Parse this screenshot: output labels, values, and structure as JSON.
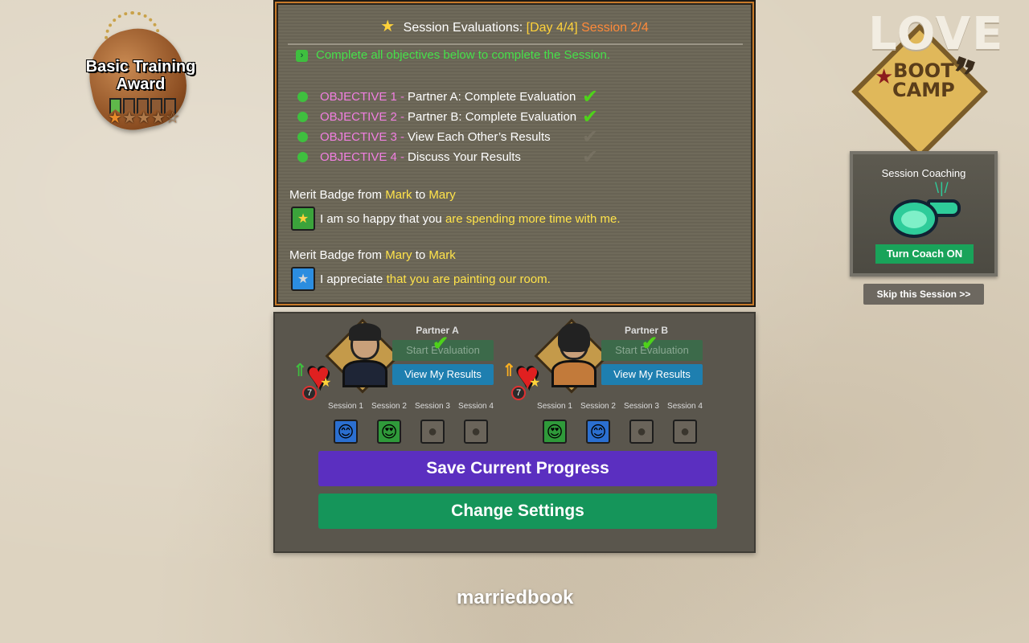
{
  "award": {
    "title": "Basic Training Award",
    "ribbons_earned": 1,
    "ribbons_total": 6,
    "stars_earned": 1,
    "stars_total": 5
  },
  "logo": {
    "line1": "LOVE",
    "line2": "BOOT",
    "line3": "CAMP"
  },
  "coach": {
    "title": "Session Coaching",
    "button": "Turn Coach ON",
    "skip": "Skip this Session >>"
  },
  "board": {
    "title": "Session Evaluations:",
    "day": "[Day 4/4]",
    "session": "Session 2/4",
    "intro": "Complete all objectives below to complete the Session.",
    "objectives": [
      {
        "tag": "OBJECTIVE 1 -",
        "text": "Partner A: Complete Evaluation",
        "done": true
      },
      {
        "tag": "OBJECTIVE 2 -",
        "text": "Partner B: Complete Evaluation",
        "done": true
      },
      {
        "tag": "OBJECTIVE 3 -",
        "text": "View Each Other’s Results",
        "done": false
      },
      {
        "tag": "OBJECTIVE 4 -",
        "text": "Discuss Your Results",
        "done": false
      }
    ],
    "badges": [
      {
        "prefix": "Merit Badge from",
        "from": "Mark",
        "to_word": "to",
        "to": "Mary",
        "msg_plain": "I am so happy that you",
        "msg_highlight": "are spending more time with me.",
        "medal_color": "green"
      },
      {
        "prefix": "Merit Badge from",
        "from": "Mary",
        "to_word": "to",
        "to": "Mark",
        "msg_plain": "I appreciate",
        "msg_highlight": "that you are painting our room.",
        "medal_color": "blue"
      }
    ]
  },
  "partners": [
    {
      "label": "Partner A",
      "level": "7",
      "start_label": "Start Evaluation",
      "results_label": "View My Results",
      "sessions": [
        {
          "label": "Session 1",
          "mood": "smile",
          "color": "blue"
        },
        {
          "label": "Session 2",
          "mood": "heart-eyes",
          "color": "green"
        },
        {
          "label": "Session 3",
          "mood": "empty",
          "color": "empty"
        },
        {
          "label": "Session 4",
          "mood": "empty",
          "color": "empty"
        }
      ]
    },
    {
      "label": "Partner B",
      "level": "7",
      "start_label": "Start Evaluation",
      "results_label": "View My Results",
      "sessions": [
        {
          "label": "Session 1",
          "mood": "heart-eyes",
          "color": "green"
        },
        {
          "label": "Session 2",
          "mood": "smile",
          "color": "blue"
        },
        {
          "label": "Session 3",
          "mood": "empty",
          "color": "empty"
        },
        {
          "label": "Session 4",
          "mood": "empty",
          "color": "empty"
        }
      ]
    }
  ],
  "actions": {
    "save": "Save Current Progress",
    "settings": "Change Settings"
  },
  "brand": "marriedbook",
  "colors": {
    "save": "#5b2fc0",
    "settings": "#15955a",
    "coach_on": "#19a35a",
    "results": "#1e7fb0",
    "objective_tag": "#f07fe0",
    "highlight": "#ffe34a"
  }
}
